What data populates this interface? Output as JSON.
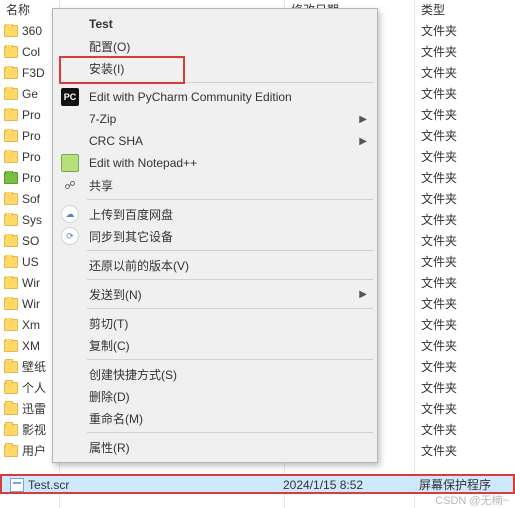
{
  "columns": {
    "name": "名称",
    "modified": "修改日期",
    "type": "类型"
  },
  "folders": [
    {
      "name": "360",
      "type": "文件夹",
      "iconClass": "folder-icon"
    },
    {
      "name": "Col",
      "type": "文件夹",
      "iconClass": "folder-icon"
    },
    {
      "name": "F3D",
      "type": "文件夹",
      "iconClass": "folder-icon"
    },
    {
      "name": "Ge",
      "type": "文件夹",
      "iconClass": "folder-icon"
    },
    {
      "name": "Pro",
      "type": "文件夹",
      "iconClass": "folder-icon"
    },
    {
      "name": "Pro",
      "type": "文件夹",
      "iconClass": "folder-icon"
    },
    {
      "name": "Pro",
      "type": "文件夹",
      "iconClass": "folder-icon"
    },
    {
      "name": "Pro",
      "type": "文件夹",
      "iconClass": "folder-icon green"
    },
    {
      "name": "Sof",
      "type": "文件夹",
      "iconClass": "folder-icon"
    },
    {
      "name": "Sys",
      "type": "文件夹",
      "iconClass": "folder-icon"
    },
    {
      "name": "SO",
      "type": "文件夹",
      "iconClass": "folder-icon"
    },
    {
      "name": "US",
      "type": "文件夹",
      "iconClass": "folder-icon"
    },
    {
      "name": "Wir",
      "type": "文件夹",
      "iconClass": "folder-icon"
    },
    {
      "name": "Wir",
      "type": "文件夹",
      "iconClass": "folder-icon"
    },
    {
      "name": "Xm",
      "type": "文件夹",
      "iconClass": "folder-icon"
    },
    {
      "name": "XM",
      "type": "文件夹",
      "iconClass": "folder-icon"
    },
    {
      "name": "壁纸",
      "type": "文件夹",
      "iconClass": "folder-icon"
    },
    {
      "name": "个人",
      "type": "文件夹",
      "iconClass": "folder-icon"
    },
    {
      "name": "迅雷",
      "type": "文件夹",
      "iconClass": "folder-icon"
    },
    {
      "name": "影视",
      "type": "文件夹",
      "iconClass": "folder-icon"
    },
    {
      "name": "用户",
      "type": "文件夹",
      "iconClass": "folder-icon"
    }
  ],
  "selected_file": {
    "name": "Test.scr",
    "modified": "2024/1/15 8:52",
    "type": "屏幕保护程序"
  },
  "context_menu": {
    "groups": [
      [
        {
          "label": "Test",
          "bold": true
        },
        {
          "label": "配置(O)"
        },
        {
          "label": "安装(I)",
          "highlight": true
        }
      ],
      [
        {
          "label": "Edit with PyCharm Community Edition",
          "icon": "pc",
          "iconText": "PC"
        },
        {
          "label": "7-Zip",
          "submenu": true
        },
        {
          "label": "CRC SHA",
          "submenu": true
        },
        {
          "label": "Edit with Notepad++",
          "icon": "npp"
        },
        {
          "label": "共享",
          "icon": "share",
          "iconText": "☍"
        }
      ],
      [
        {
          "label": "上传到百度网盘",
          "icon": "baidu",
          "iconText": "☁"
        },
        {
          "label": "同步到其它设备",
          "icon": "sync",
          "iconText": "⟳"
        }
      ],
      [
        {
          "label": "还原以前的版本(V)"
        }
      ],
      [
        {
          "label": "发送到(N)",
          "submenu": true
        }
      ],
      [
        {
          "label": "剪切(T)"
        },
        {
          "label": "复制(C)"
        }
      ],
      [
        {
          "label": "创建快捷方式(S)"
        },
        {
          "label": "删除(D)"
        },
        {
          "label": "重命名(M)"
        }
      ],
      [
        {
          "label": "属性(R)"
        }
      ]
    ]
  },
  "watermark": "CSDN @无楠~"
}
